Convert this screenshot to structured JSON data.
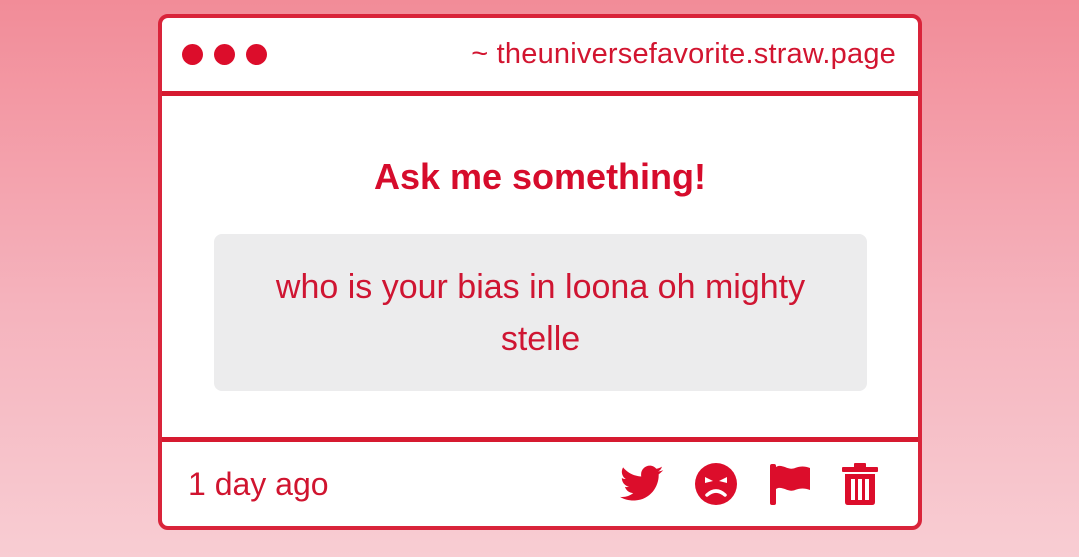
{
  "window": {
    "url": "~ theuniversefavorite.straw.page"
  },
  "card": {
    "heading": "Ask me something!",
    "question": "who is your bias in loona oh mighty stelle"
  },
  "footer": {
    "timestamp": "1 day ago",
    "actions": [
      "twitter-icon",
      "angry-face-icon",
      "flag-icon",
      "trash-icon"
    ]
  },
  "colors": {
    "accent": "#dc0d2b",
    "question_bg": "#ececed",
    "background_top": "#f28c98",
    "background_bottom": "#f8cdd3"
  }
}
